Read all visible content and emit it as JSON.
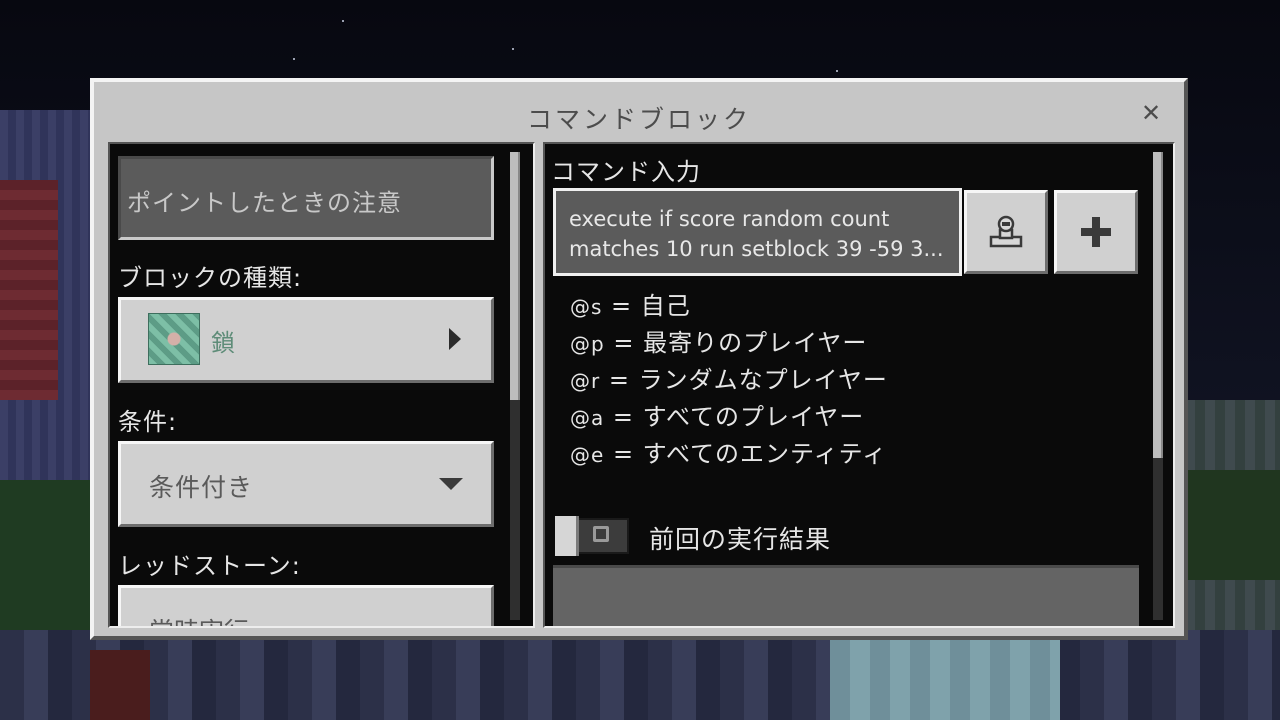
{
  "dialog": {
    "title": "コマンドブロック",
    "close_label": "✕"
  },
  "left": {
    "tooltip_placeholder": "ポイントしたときの注意",
    "block_type_label": "ブロックの種類:",
    "block_type_value": "鎖",
    "condition_label": "条件:",
    "condition_value": "条件付き",
    "redstone_label": "レッドストーン:",
    "redstone_value": "常時実行"
  },
  "right": {
    "command_label": "コマンド入力",
    "command_line1": "execute if score random count",
    "command_line2": "matches 10 run setblock 39 -59 3...",
    "help": [
      {
        "sym": "@s",
        "text": " = 自己"
      },
      {
        "sym": "@p",
        "text": " = 最寄りのプレイヤー"
      },
      {
        "sym": "@r",
        "text": " = ランダムなプレイヤー"
      },
      {
        "sym": "@a",
        "text": " = すべてのプレイヤー"
      },
      {
        "sym": "@e",
        "text": " = すべてのエンティティ"
      }
    ],
    "last_output_label": "前回の実行結果",
    "last_output_enabled": false
  },
  "icons": {
    "close": "close-icon",
    "block": "chain-command-block-icon",
    "arrow": "chevron-right-icon",
    "dropdown": "chevron-down-icon",
    "cmd_builder": "command-builder-icon",
    "add": "plus-icon"
  },
  "colors": {
    "dialog_bg": "#c6c6c6",
    "panel_bg": "#0a0a0a",
    "field_dark": "#5b5b5b",
    "text_light": "#e6e6e6",
    "block_name": "#5e8c78"
  }
}
